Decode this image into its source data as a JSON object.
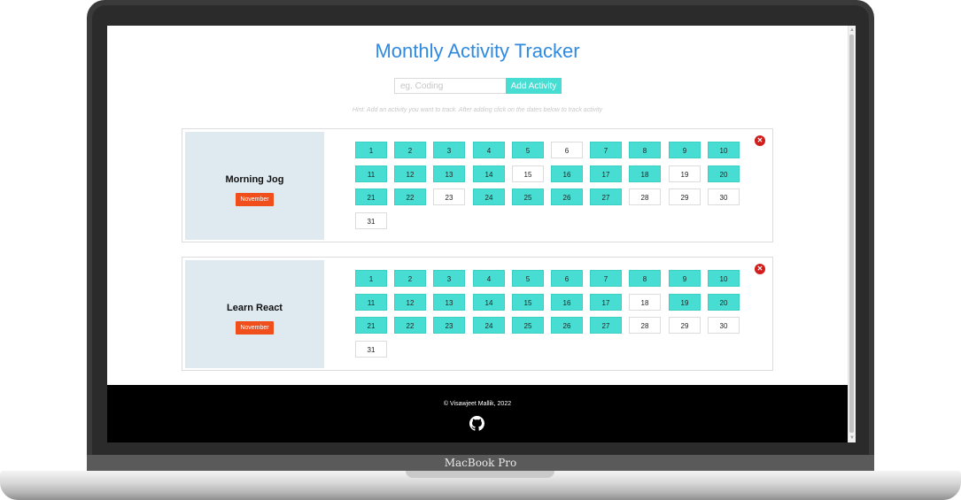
{
  "app": {
    "title": "Monthly Activity Tracker"
  },
  "form": {
    "placeholder": "eg. Coding",
    "value": "",
    "add_label": "Add Activity"
  },
  "hint": "Hint: Add an activity you want to track. After adding click on the dates below to track activity",
  "activities": [
    {
      "name": "Morning Jog",
      "month": "November",
      "days": [
        1,
        2,
        3,
        4,
        5,
        6,
        7,
        8,
        9,
        10,
        11,
        12,
        13,
        14,
        15,
        16,
        17,
        18,
        19,
        20,
        21,
        22,
        23,
        24,
        25,
        26,
        27,
        28,
        29,
        30,
        31
      ],
      "done": [
        1,
        2,
        3,
        4,
        5,
        7,
        8,
        9,
        10,
        11,
        12,
        13,
        14,
        16,
        17,
        18,
        20,
        21,
        22,
        24,
        25,
        26,
        27
      ]
    },
    {
      "name": "Learn React",
      "month": "November",
      "days": [
        1,
        2,
        3,
        4,
        5,
        6,
        7,
        8,
        9,
        10,
        11,
        12,
        13,
        14,
        15,
        16,
        17,
        18,
        19,
        20,
        21,
        22,
        23,
        24,
        25,
        26,
        27,
        28,
        29,
        30,
        31
      ],
      "done": [
        1,
        2,
        3,
        4,
        5,
        6,
        7,
        8,
        9,
        10,
        11,
        12,
        13,
        14,
        15,
        16,
        17,
        19,
        20,
        21,
        22,
        23,
        24,
        25,
        26,
        27
      ]
    }
  ],
  "footer": {
    "copyright": "© Visawjeet Mallik, 2022"
  },
  "device": {
    "brand": "MacBook Pro"
  },
  "colors": {
    "accent": "#48ddd2",
    "title": "#2f8ae0",
    "badge": "#f04e1a",
    "delete": "#d21d1d",
    "card_left": "#dfeaf0"
  },
  "icons": [
    "delete-icon",
    "github-icon"
  ]
}
